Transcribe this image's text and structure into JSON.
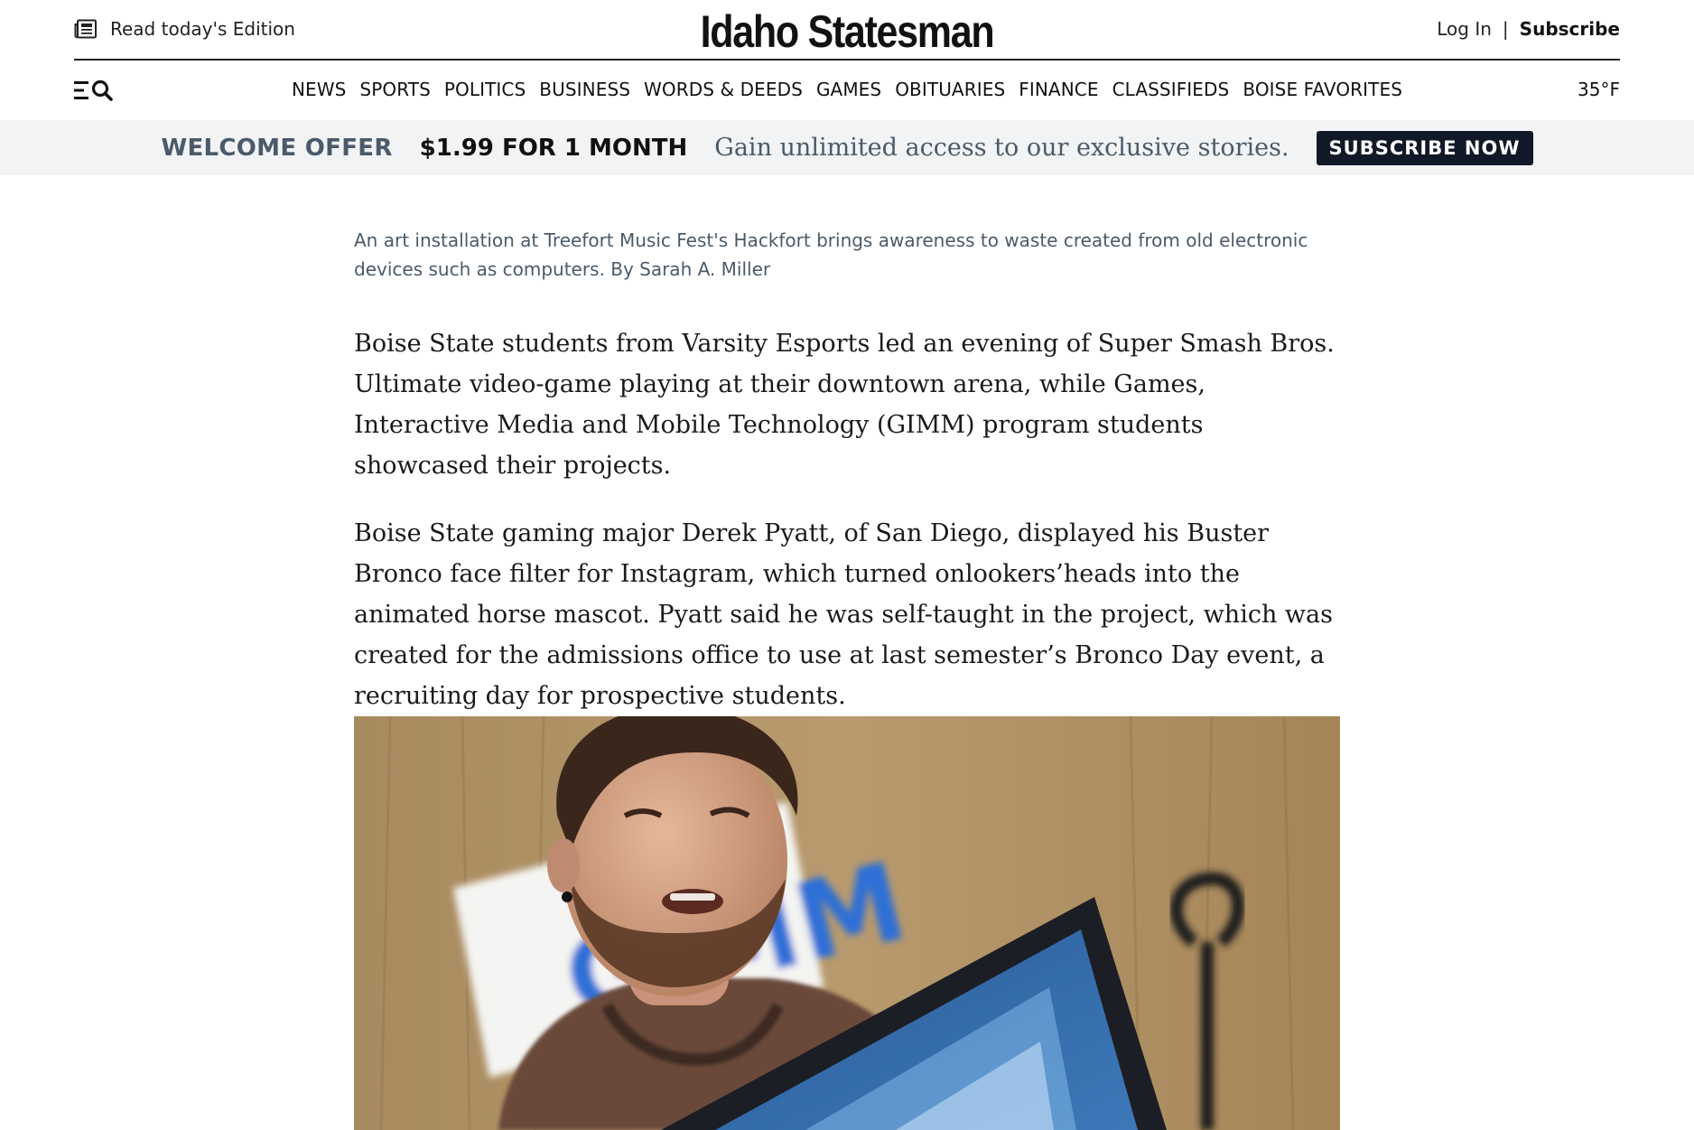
{
  "header": {
    "edition_label": "Read today's Edition",
    "logo_text": "Idaho Statesman",
    "login_label": "Log In",
    "separator": "|",
    "subscribe_label": "Subscribe"
  },
  "nav": {
    "items": [
      "NEWS",
      "SPORTS",
      "POLITICS",
      "BUSINESS",
      "WORDS & DEEDS",
      "GAMES",
      "OBITUARIES",
      "FINANCE",
      "CLASSIFIEDS",
      "BOISE FAVORITES"
    ],
    "temperature": "35°F"
  },
  "offer": {
    "welcome": "WELCOME OFFER",
    "price": "$1.99 FOR 1 MONTH",
    "tagline": "Gain unlimited access to our exclusive stories.",
    "cta": "SUBSCRIBE NOW"
  },
  "article": {
    "video_caption": "An art installation at Treefort Music Fest's Hackfort brings awareness to waste created from old electronic devices such as computers. By Sarah A. Miller",
    "paragraphs": [
      "Boise State students from Varsity Esports led an evening of Super Smash Bros. Ultimate video-game playing at their downtown arena, while Games, Interactive Media and Mobile Technology (GIMM) program students showcased their projects.",
      "Boise State gaming major Derek Pyatt, of San Diego, displayed his Buster Bronco face filter for Instagram, which turned onlookers’heads into the animated horse mascot. Pyatt said he was self-taught in the project, which was created for the admissions office to use at last semester’s Bronco Day event, a recruiting day for prospective students."
    ],
    "photo_sign_text": "GIMM"
  },
  "colors": {
    "banner_bg": "#f1f3f5",
    "muted_text": "#4a5a6a",
    "cta_bg": "#111827",
    "photo_wall": "#b2946a",
    "sign_blue": "#2f6fd6"
  },
  "icons": {
    "edition": "newspaper-icon",
    "menu_search": "menu-search-icon"
  }
}
